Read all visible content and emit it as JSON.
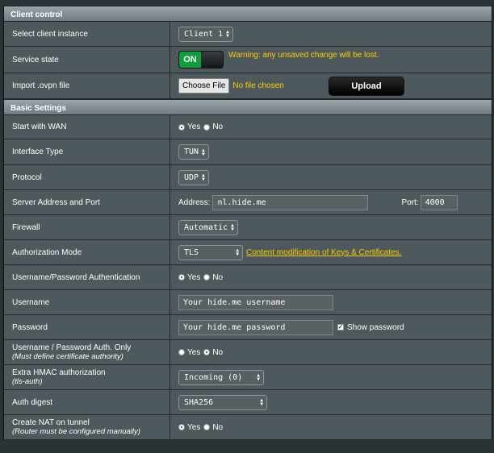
{
  "client_control": {
    "header": "Client control",
    "select_instance": {
      "label": "Select client instance",
      "value": "Client 1"
    },
    "service_state": {
      "label": "Service state",
      "toggle": "ON",
      "warning": "Warning: any unsaved change will be lost."
    },
    "import_ovpn": {
      "label": "Import .ovpn file",
      "choose_button": "Choose File",
      "file_status": "No file chosen",
      "upload_button": "Upload"
    }
  },
  "basic_settings": {
    "header": "Basic Settings",
    "start_with_wan": {
      "label": "Start with WAN",
      "yes": "Yes",
      "no": "No",
      "selected": "Yes"
    },
    "interface_type": {
      "label": "Interface Type",
      "value": "TUN"
    },
    "protocol": {
      "label": "Protocol",
      "value": "UDP"
    },
    "server": {
      "label": "Server Address and Port",
      "address_label": "Address:",
      "address_value": "nl.hide.me",
      "port_label": "Port:",
      "port_value": "4000"
    },
    "firewall": {
      "label": "Firewall",
      "value": "Automatic"
    },
    "auth_mode": {
      "label": "Authorization Mode",
      "value": "TLS",
      "link": "Content modification of Keys & Certificates."
    },
    "userpass_auth": {
      "label": "Username/Password Authentication",
      "yes": "Yes",
      "no": "No",
      "selected": "Yes"
    },
    "username": {
      "label": "Username",
      "value": "Your hide.me username"
    },
    "password": {
      "label": "Password",
      "value": "Your hide.me password",
      "show_label": "Show password",
      "show_checked": true
    },
    "auth_only": {
      "label": "Username / Password Auth. Only",
      "sublabel": "(Must define certificate authority)",
      "yes": "Yes",
      "no": "No",
      "selected": "No"
    },
    "hmac": {
      "label": "Extra HMAC authorization",
      "sublabel": "(tls-auth)",
      "value": "Incoming (0)"
    },
    "auth_digest": {
      "label": "Auth digest",
      "value": "SHA256"
    },
    "nat": {
      "label": "Create NAT on tunnel",
      "sublabel": "(Router must be configured manually)",
      "yes": "Yes",
      "no": "No",
      "selected": "Yes"
    }
  }
}
